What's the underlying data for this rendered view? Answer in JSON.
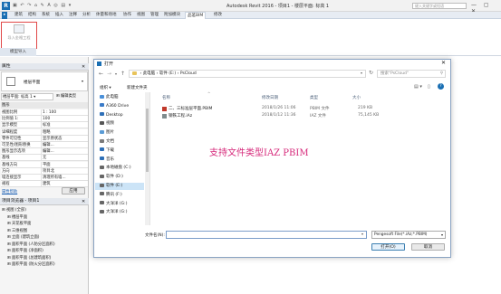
{
  "app": {
    "title": "Autodesk Revit 2016 - 项目1 - 楼层平面: 标高 1",
    "search_placeholder": "键入关键字或短语",
    "user": "登录"
  },
  "ribbon_tabs": [
    "建筑",
    "结构",
    "系统",
    "插入",
    "注释",
    "分析",
    "体量和场地",
    "协作",
    "视图",
    "管理",
    "附加模块",
    "品茗BIM",
    "修改"
  ],
  "ribbon": {
    "import_button_label": "导入金格工程",
    "panel_label": "模型导入"
  },
  "properties": {
    "title": "属性",
    "type_name": "楼层平面",
    "selector": "楼层平面: 标高 1",
    "edit_type": "编辑类型",
    "section": "图形",
    "rows": [
      {
        "k": "视图比例",
        "v": "1 : 100"
      },
      {
        "k": "比例值 1:",
        "v": "100"
      },
      {
        "k": "显示模型",
        "v": "标准"
      },
      {
        "k": "详细程度",
        "v": "粗略"
      },
      {
        "k": "零件可见性",
        "v": "显示原状态"
      },
      {
        "k": "可见性/图形替换",
        "v": "编辑..."
      },
      {
        "k": "图形显示选项",
        "v": "编辑..."
      },
      {
        "k": "基线",
        "v": "无"
      },
      {
        "k": "基线方向",
        "v": "平面"
      },
      {
        "k": "方向",
        "v": "项目北"
      },
      {
        "k": "墙连接显示",
        "v": "清理所有墙..."
      },
      {
        "k": "规程",
        "v": "建筑"
      }
    ],
    "help_link": "属性帮助",
    "apply_button": "应用"
  },
  "project_browser": {
    "title": "项目浏览器 - 项目1",
    "items": [
      {
        "label": "视图 (全部)",
        "indent": 0
      },
      {
        "label": "楼层平面",
        "indent": 1
      },
      {
        "label": "天花板平面",
        "indent": 1
      },
      {
        "label": "三维视图",
        "indent": 1
      },
      {
        "label": "立面 (建筑立面)",
        "indent": 1
      },
      {
        "label": "面积平面 (人防分区面积)",
        "indent": 1
      },
      {
        "label": "面积平面 (净面积)",
        "indent": 1
      },
      {
        "label": "面积平面 (总建筑面积)",
        "indent": 1
      },
      {
        "label": "面积平面 (防火分区面积)",
        "indent": 1
      }
    ]
  },
  "dialog": {
    "title": "打开",
    "path_parts": [
      "此电脑",
      "软件 (E:)",
      "PsCloud"
    ],
    "search_placeholder": "搜索\"PsCloud\"",
    "organize": "组织 ▾",
    "new_folder": "新建文件夹",
    "columns": [
      "名称",
      "修改日期",
      "类型",
      "大小"
    ],
    "sidebar": [
      {
        "label": "此电脑",
        "icon": "computer-icon",
        "color": "#4a90d9"
      },
      {
        "label": "A360 Drive",
        "icon": "cloud-icon",
        "color": "#3a7bc8"
      },
      {
        "label": "Desktop",
        "icon": "desktop-icon",
        "color": "#2e6fb7"
      },
      {
        "label": "视频",
        "icon": "video-icon",
        "color": "#555"
      },
      {
        "label": "图片",
        "icon": "picture-icon",
        "color": "#5a9bd5"
      },
      {
        "label": "文档",
        "icon": "document-icon",
        "color": "#7a7a7a"
      },
      {
        "label": "下载",
        "icon": "download-icon",
        "color": "#2e6fb7"
      },
      {
        "label": "音乐",
        "icon": "music-icon",
        "color": "#2e6fb7"
      },
      {
        "label": "本地磁盘 (C:)",
        "icon": "drive-icon",
        "color": "#666"
      },
      {
        "label": "软件 (D:)",
        "icon": "drive-icon",
        "color": "#666"
      },
      {
        "label": "软件 (E:)",
        "icon": "drive-icon",
        "color": "#666"
      },
      {
        "label": "腾讯 (F:)",
        "icon": "drive-icon",
        "color": "#666"
      },
      {
        "label": "大洋洋 (G:)",
        "icon": "drive-icon",
        "color": "#666"
      },
      {
        "label": "大洋洋 (G:)",
        "icon": "drive-icon",
        "color": "#666"
      }
    ],
    "files": [
      {
        "name": "二、三标准层平面.PBIM",
        "date": "2018/1/26 11:06",
        "type": "PBIM 文件",
        "size": "219 KB",
        "icon_color": "#c0392b"
      },
      {
        "name": "钢铁工程.iAz",
        "date": "2018/1/12 11:36",
        "type": "IAZ 文件",
        "size": "75,145 KB",
        "icon_color": "#7f8c8d"
      }
    ],
    "annotation": "支持文件类型IAZ PBIM",
    "filename_label": "文件名(N):",
    "filename_value": "",
    "filetype": "Pengesoft File(*.iAz;*.PBIM)",
    "open_button": "打开(O)",
    "cancel_button": "取消"
  },
  "colors": {
    "accent": "#2e6fb7",
    "annotation": "#d6287a",
    "highlight_box": "#e04848"
  }
}
